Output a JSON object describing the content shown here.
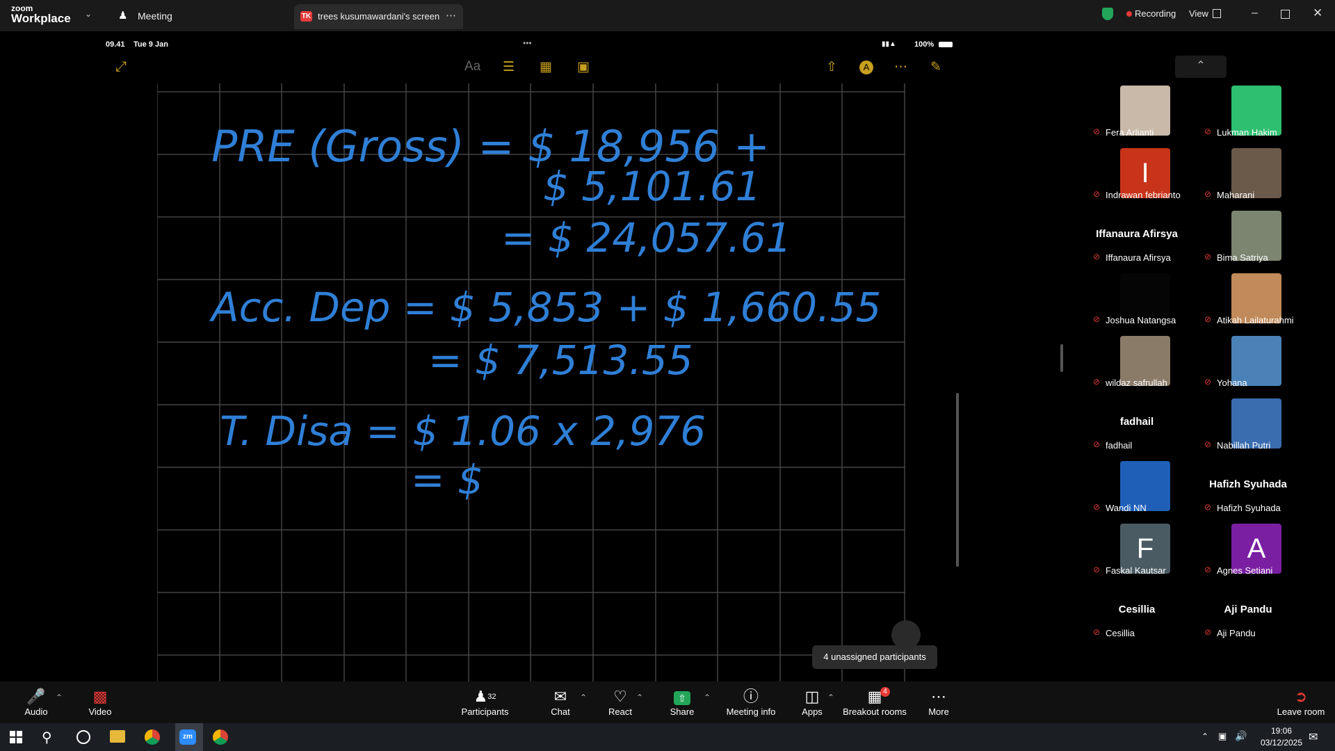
{
  "app": {
    "brand_top": "zoom",
    "brand_bottom": "Workplace"
  },
  "titlebar": {
    "meeting_label": "Meeting",
    "tab_badge": "TK",
    "tab_title": "trees kusumawardani's screen",
    "recording": "Recording",
    "view": "View"
  },
  "ipad": {
    "time": "09.41",
    "date": "Tue 9 Jan",
    "battery": "100%",
    "handwriting": {
      "line1": "PRE (Gross) = $ 18,956 +",
      "line2": "$ 5,101.61",
      "line3": "= $ 24,057.61",
      "line4": "Acc. Dep = $ 5,853 + $ 1,660.55",
      "line5": "= $ 7,513.55",
      "line6": "T. Disa = $ 1.06 x 2,976",
      "line7": "= $"
    }
  },
  "participants": [
    {
      "name": "Fera Arlianti",
      "type": "video",
      "color": "#c9b9a8"
    },
    {
      "name": "Lukman Hakim",
      "type": "video",
      "color": "#2fbf71"
    },
    {
      "name": "Indrawan febrianto",
      "type": "initial",
      "initial": "I",
      "color": "#c8341a"
    },
    {
      "name": "Maharani",
      "type": "video",
      "color": "#6b5a4a"
    },
    {
      "name": "Iffanaura Afirsya",
      "type": "name",
      "big": "Iffanaura Afirsya"
    },
    {
      "name": "Bima Satriya",
      "type": "video",
      "color": "#7c8570"
    },
    {
      "name": "Joshua Natangsa",
      "type": "video",
      "color": "#050505"
    },
    {
      "name": "Atikah Lailaturahmi",
      "type": "video",
      "color": "#c08a5a"
    },
    {
      "name": "wildaz safrullah",
      "type": "video",
      "color": "#8a7a68"
    },
    {
      "name": "Yohana",
      "type": "video",
      "color": "#4a82b8"
    },
    {
      "name": "fadhail",
      "type": "name",
      "big": "fadhail"
    },
    {
      "name": "Nabillah Putri",
      "type": "video",
      "color": "#3a6cb0"
    },
    {
      "name": "Wandi NN",
      "type": "video",
      "color": "#1f5fb8"
    },
    {
      "name": "Hafizh Syuhada",
      "type": "name",
      "big": "Hafizh Syuhada"
    },
    {
      "name": "Faskal Kautsar",
      "type": "initial",
      "initial": "F",
      "color": "#4a5b63"
    },
    {
      "name": "Agnes Setiani",
      "type": "initial",
      "initial": "A",
      "color": "#7a1fa2"
    },
    {
      "name": "Cesillia",
      "type": "name",
      "big": "Cesillia"
    },
    {
      "name": "Aji Pandu",
      "type": "name",
      "big": "Aji Pandu"
    }
  ],
  "tooltip": "4 unassigned participants",
  "toolbar": {
    "audio": "Audio",
    "video": "Video",
    "participants": "Participants",
    "participants_count": "32",
    "chat": "Chat",
    "react": "React",
    "share": "Share",
    "meeting_info": "Meeting info",
    "apps": "Apps",
    "breakout": "Breakout rooms",
    "breakout_badge": "4",
    "more": "More",
    "leave": "Leave room"
  },
  "taskbar": {
    "time": "19:06",
    "date": "03/12/2025"
  },
  "colors": {
    "ink": "#2f7fd6",
    "accent_green": "#23a55a",
    "mute_red": "#e53935"
  }
}
